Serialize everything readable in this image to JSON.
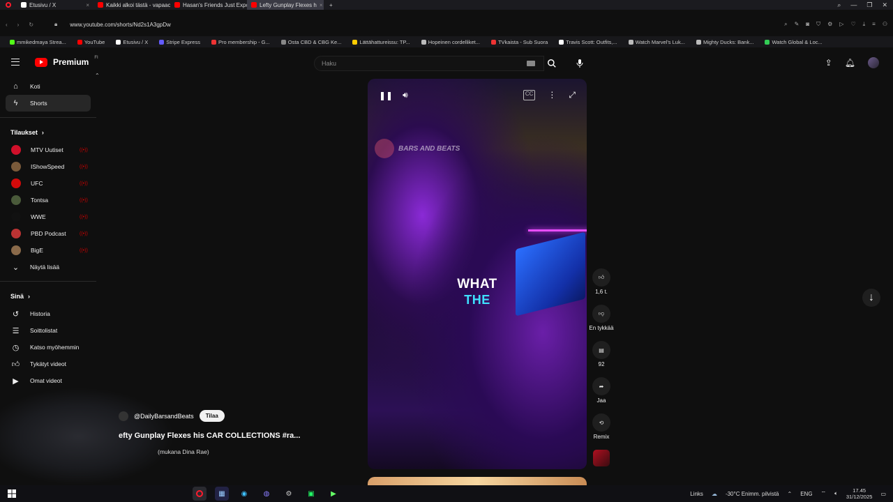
{
  "browser": {
    "tabs": [
      {
        "label": "Etusivu / X",
        "fav": "#ffffff"
      },
      {
        "label": "Kaikki alkoi tästä - vapaaс",
        "fav": "#ff0000"
      },
      {
        "label": "Hasan's Friends Just Expo",
        "fav": "#ff0000"
      },
      {
        "label": "Lefty Gunplay Flexes h",
        "fav": "#ff0000",
        "active": true
      }
    ],
    "url": "www.youtube.com/shorts/Nd2s1A3gpDw",
    "bookmarks": [
      {
        "label": "mmikedmaya Strea...",
        "color": "#53fc18"
      },
      {
        "label": "YouTube",
        "color": "#ff0000"
      },
      {
        "label": "Etusivu / X",
        "color": "#ffffff"
      },
      {
        "label": "Stripe Express",
        "color": "#635bff"
      },
      {
        "label": "Pro membership - G...",
        "color": "#e33"
      },
      {
        "label": "Osta CBD & CBG Ke...",
        "color": "#888"
      },
      {
        "label": "Lättähattureissu: TP...",
        "color": "#ffcc00"
      },
      {
        "label": "Hopeinen cordelliket...",
        "color": "#bbb"
      },
      {
        "label": "TVkaista - Sub Suora",
        "color": "#e33"
      },
      {
        "label": "Travis Scott: Outfits,...",
        "color": "#fff"
      },
      {
        "label": "Watch Marvel's Luk...",
        "color": "#bbb"
      },
      {
        "label": "Mighty Ducks: Bank...",
        "color": "#bbb"
      },
      {
        "label": "Watch Global & Loc...",
        "color": "#33cc55"
      }
    ]
  },
  "header": {
    "brand": "Premium",
    "brand_sup": "FI",
    "search_placeholder": "Haku"
  },
  "sidebar": {
    "main": [
      {
        "label": "Koti",
        "icon": "home-icon"
      },
      {
        "label": "Shorts",
        "icon": "shorts-icon",
        "active": true
      }
    ],
    "subscriptions_title": "Tilaukset",
    "subscriptions": [
      {
        "label": "MTV Uutiset",
        "color": "#d0102a"
      },
      {
        "label": "IShowSpeed",
        "color": "#7a5a3a"
      },
      {
        "label": "UFC",
        "color": "#d20a0a"
      },
      {
        "label": "Tontsa",
        "color": "#4a5a3a"
      },
      {
        "label": "WWE",
        "color": "#111111"
      },
      {
        "label": "PBD Podcast",
        "color": "#b33"
      },
      {
        "label": "BigE",
        "color": "#8a6a4a"
      }
    ],
    "show_more": "Näytä lisää",
    "you_title": "Sinä",
    "you": [
      {
        "label": "Historia",
        "icon": "history-icon"
      },
      {
        "label": "Soittolistat",
        "icon": "playlist-icon"
      },
      {
        "label": "Katso myöhemmin",
        "icon": "watch-later-icon"
      },
      {
        "label": "Tykätyt videot",
        "icon": "like-icon"
      },
      {
        "label": "Omat videot",
        "icon": "video-icon"
      }
    ]
  },
  "video": {
    "caption_line1": "WHAT",
    "caption_line2": "THE",
    "watermark": "BARS AND BEATS",
    "channel": "@DailyBarsandBeats",
    "subscribe": "Tilaa",
    "title": "efty Gunplay Flexes his CAR COLLECTIONS #ra...",
    "music": "(mukana Dina Rae)"
  },
  "actions": {
    "likes": "1,6 t.",
    "dislike": "En tykkää",
    "comments": "92",
    "share": "Jaa",
    "remix": "Remix"
  },
  "taskbar": {
    "links": "Links",
    "weather": "-30°C  Enimm. pilvistä",
    "lang": "ENG",
    "time": "17.45",
    "date": "31/12/2025"
  }
}
